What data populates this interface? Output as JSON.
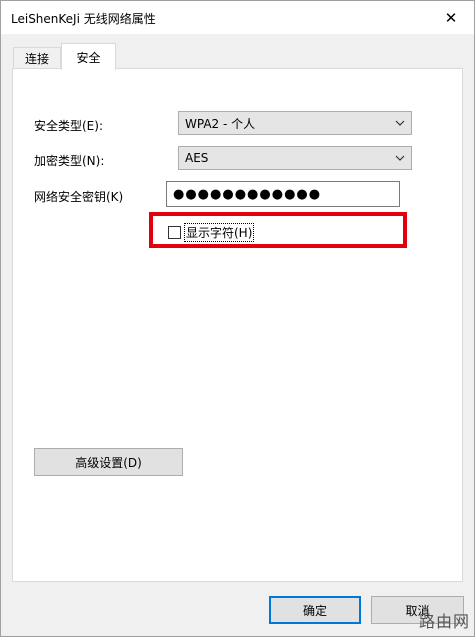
{
  "window": {
    "title": "LeiShenKeJi 无线网络属性",
    "close_glyph": "✕"
  },
  "tabs": [
    {
      "label": "连接",
      "active": false
    },
    {
      "label": "安全",
      "active": true
    }
  ],
  "security": {
    "type_label": "安全类型(E):",
    "type_value": "WPA2 - 个人",
    "encryption_label": "加密类型(N):",
    "encryption_value": "AES",
    "key_label": "网络安全密钥(K)",
    "key_value": "●●●●●●●●●●●●",
    "show_chars_label": "显示字符(H)",
    "show_chars_checked": false
  },
  "buttons": {
    "advanced": "高级设置(D)",
    "ok": "确定",
    "cancel": "取消"
  },
  "watermark": "路由网",
  "colors": {
    "highlight": "#e0000f",
    "focus": "#0078d7"
  }
}
